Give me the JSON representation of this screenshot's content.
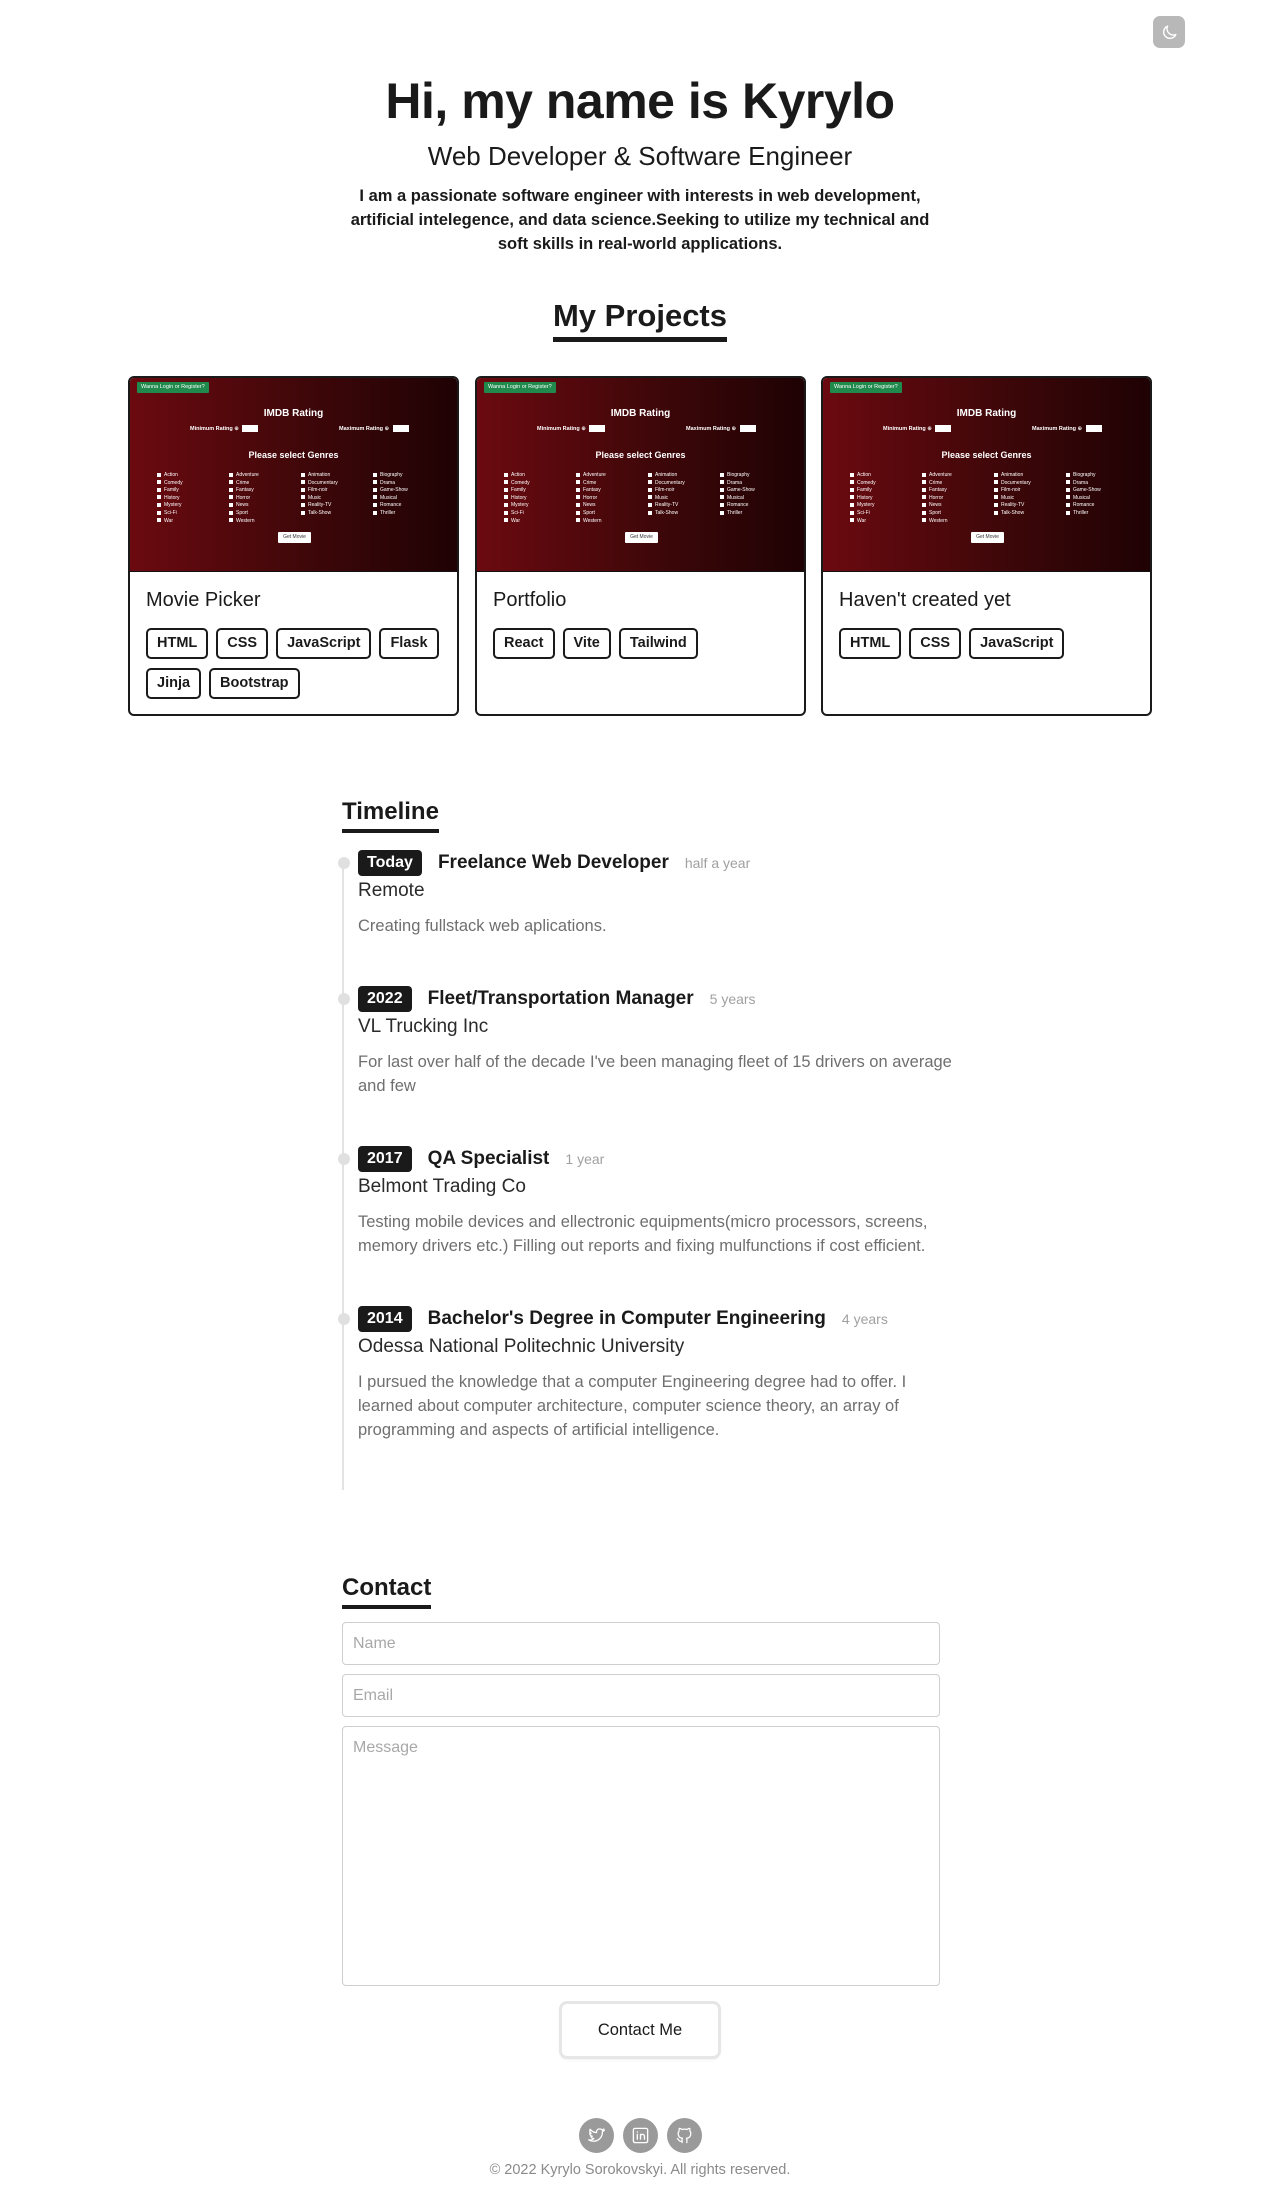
{
  "theme_toggle": {
    "icon": "moon-icon"
  },
  "hero": {
    "title": "Hi, my name is Kyrylo",
    "subtitle": "Web Developer & Software Engineer",
    "intro": "I am a passionate software engineer with interests in web development, artificial intelegence, and data science.Seeking to utilize my technical and soft skills in real-world applications."
  },
  "projects": {
    "heading": "My Projects",
    "screenshot": {
      "login_label": "Wanna Login or Register?",
      "imdb_title": "IMDB Rating",
      "min_label": "Minimum Rating ⊕",
      "max_label": "Maximum Rating ⊕",
      "genres_title": "Please select Genres",
      "genres": [
        "Action",
        "Adventure",
        "Animation",
        "Biography",
        "Comedy",
        "Crime",
        "Documentary",
        "Drama",
        "Family",
        "Fantasy",
        "Film-noir",
        "Game-Show",
        "History",
        "Horror",
        "Music",
        "Musical",
        "Mystery",
        "News",
        "Reality-TV",
        "Romance",
        "Sci-Fi",
        "Sport",
        "Talk-Show",
        "Thriller",
        "War",
        "Western"
      ],
      "button_label": "Get Movie"
    },
    "items": [
      {
        "name": "Movie Picker",
        "tags": [
          "HTML",
          "CSS",
          "JavaScript",
          "Flask",
          "Jinja",
          "Bootstrap"
        ]
      },
      {
        "name": "Portfolio",
        "tags": [
          "React",
          "Vite",
          "Tailwind"
        ]
      },
      {
        "name": "Haven't created yet",
        "tags": [
          "HTML",
          "CSS",
          "JavaScript"
        ]
      }
    ]
  },
  "timeline": {
    "heading": "Timeline",
    "items": [
      {
        "date": "Today",
        "role": "Freelance Web Developer",
        "duration": "half a year",
        "org": "Remote",
        "desc": "Creating fullstack web aplications."
      },
      {
        "date": "2022",
        "role": "Fleet/Transportation Manager",
        "duration": "5 years",
        "org": "VL Trucking Inc",
        "desc": "For last over half of the decade I've been managing fleet of 15 drivers on average and few"
      },
      {
        "date": "2017",
        "role": "QA Specialist",
        "duration": "1 year",
        "org": "Belmont Trading Co",
        "desc": "Testing mobile devices and ellectronic equipments(micro processors, screens, memory drivers etc.) Filling out reports and fixing mulfunctions if cost efficient."
      },
      {
        "date": "2014",
        "role": "Bachelor's Degree in Computer Engineering",
        "duration": "4 years",
        "org": "Odessa National Politechnic University",
        "desc": "I pursued the knowledge that a computer Engineering degree had to offer. I learned about computer architecture, computer science theory, an array of programming and aspects of artificial intelligence."
      }
    ]
  },
  "contact": {
    "heading": "Contact",
    "name_placeholder": "Name",
    "email_placeholder": "Email",
    "message_placeholder": "Message",
    "button_label": "Contact Me"
  },
  "footer": {
    "socials": [
      {
        "icon": "twitter-icon"
      },
      {
        "icon": "linkedin-icon"
      },
      {
        "icon": "github-icon"
      }
    ],
    "copyright": "© 2022 Kyrylo Sorokovskyi. All rights reserved."
  }
}
